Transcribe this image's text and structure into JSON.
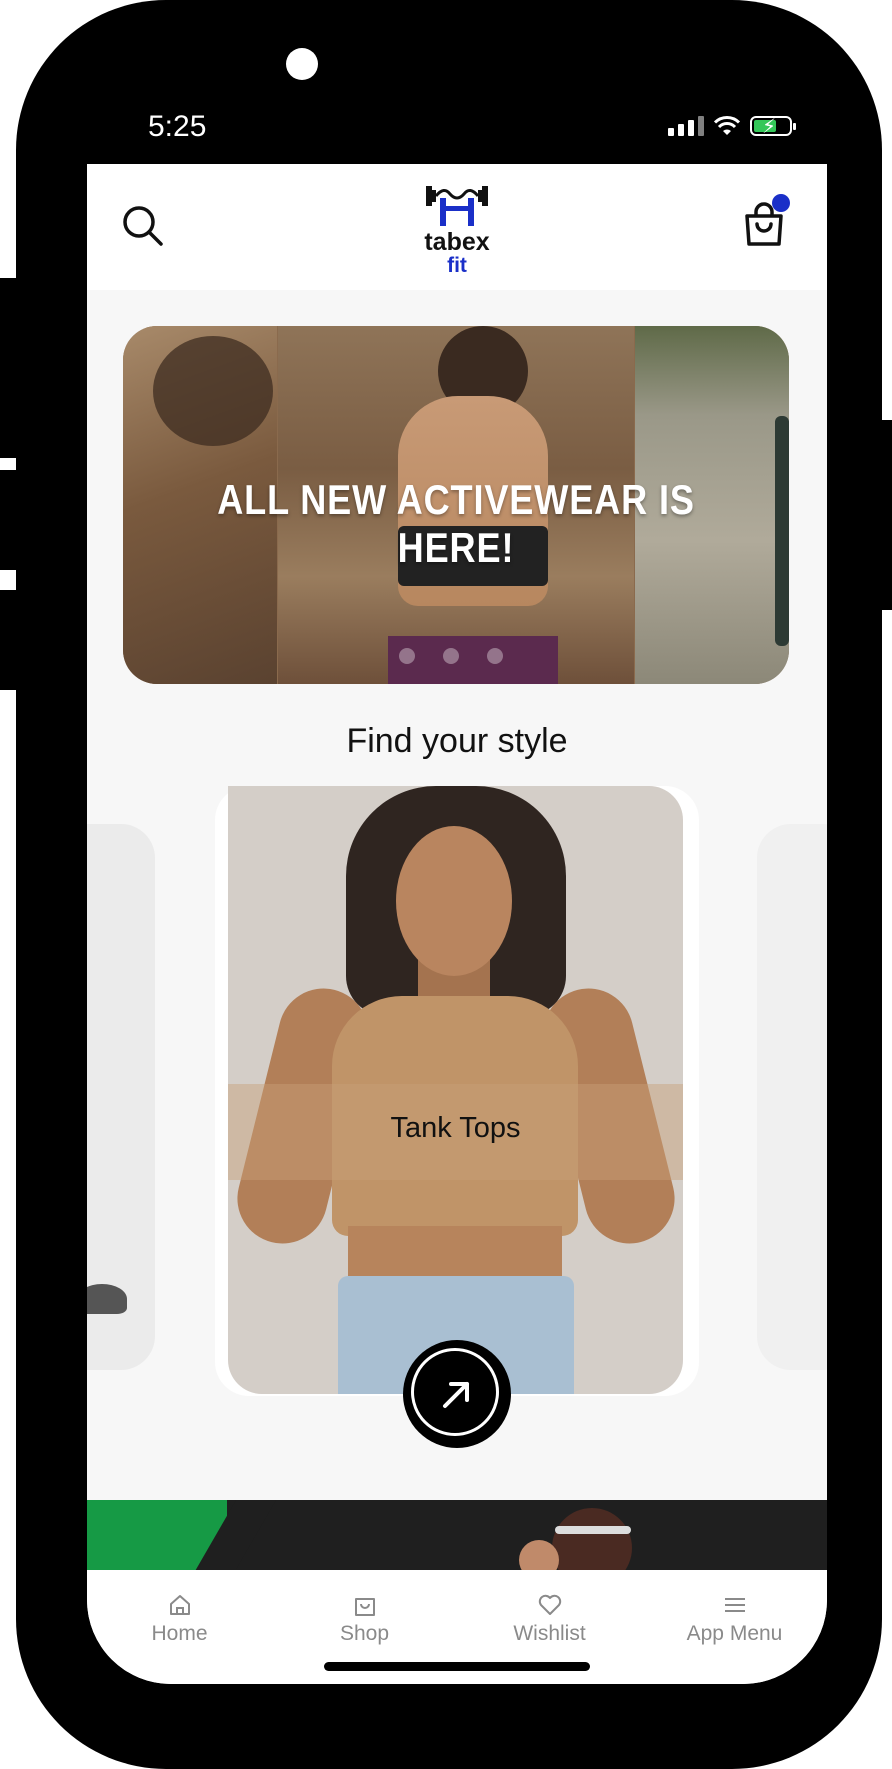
{
  "status_bar": {
    "time": "5:25"
  },
  "header": {
    "logo_line1": "tabex",
    "logo_line2": "fit",
    "search_icon": "search-icon",
    "cart_icon": "shopping-bag-icon",
    "cart_badge_color": "#1a2fc8"
  },
  "banner": {
    "headline": "ALL NEW ACTIVEWEAR IS HERE!",
    "slide_count": 3
  },
  "section": {
    "title": "Find your style"
  },
  "category_card": {
    "label": "Tank Tops",
    "action_icon": "arrow-up-right-icon"
  },
  "tabbar": {
    "items": [
      {
        "label": "Home",
        "icon": "home-icon"
      },
      {
        "label": "Shop",
        "icon": "shopping-bag-icon"
      },
      {
        "label": "Wishlist",
        "icon": "heart-icon"
      },
      {
        "label": "App Menu",
        "icon": "menu-icon"
      }
    ]
  },
  "colors": {
    "accent": "#1a2fc8",
    "promo_green": "#169a45"
  }
}
